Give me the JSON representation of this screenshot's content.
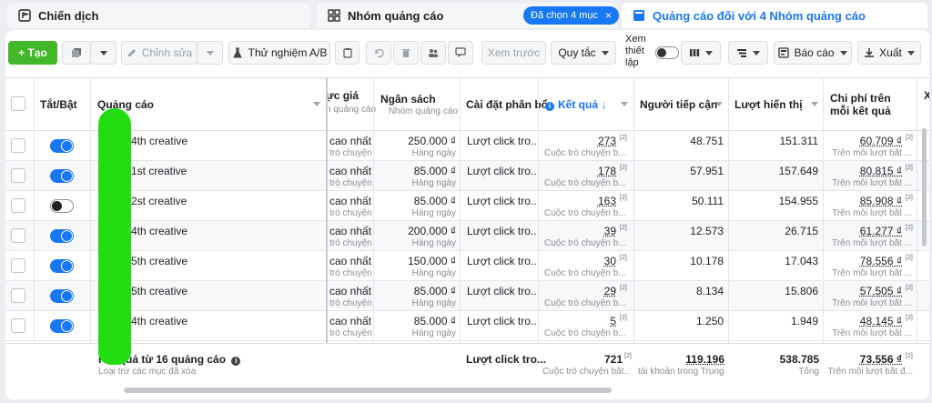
{
  "tabs": [
    {
      "label": "Chiến dịch"
    },
    {
      "label": "Nhóm quảng cáo"
    },
    {
      "label": "Quảng cáo đối với 4 Nhóm quảng cáo"
    }
  ],
  "selection_chip": {
    "label": "Đã chọn 4 mục",
    "close": "×"
  },
  "toolbar": {
    "create": "+ Tạo",
    "edit": "Chỉnh sửa",
    "ab_test": "Thử nghiệm A/B",
    "preview": "Xem trước",
    "rules": "Quy tắc",
    "view_setup": "Xem thiết lập",
    "reports": "Báo cáo",
    "export": "Xuất"
  },
  "columns": {
    "toggle": "Tắt/Bật",
    "ad": "Quảng cáo",
    "bid": "ực giá",
    "bid_sub": "n quảng cáo",
    "budget": "Ngân sách",
    "budget_sub": "Nhóm quảng cáo",
    "delivery": "Cài đặt phân bổ",
    "results": "Kết quả ↓",
    "reach": "Người tiếp cận",
    "impressions": "Lượt hiển thị",
    "cost": "Chi phí trên mỗi kết quả",
    "more": "X"
  },
  "rows": [
    {
      "enabled": true,
      "name": "4th creative",
      "bid": "cao nhất",
      "bid_sub": "trò chuyện",
      "budget": "250.000 ₫",
      "budget_sub": "Hàng ngày",
      "delivery": "Lượt click tro...",
      "results": "273",
      "results_sub": "Cuộc trò chuyện b...",
      "reach": "48.751",
      "impressions": "151.311",
      "cost": "60.709 ₫",
      "cost_sub": "Trên mỗi lượt bắt ..."
    },
    {
      "enabled": true,
      "name": "1st creative",
      "bid": "cao nhất",
      "bid_sub": "trò chuyện",
      "budget": "85.000 ₫",
      "budget_sub": "Hàng ngày",
      "delivery": "Lượt click tro...",
      "results": "178",
      "results_sub": "Cuộc trò chuyện b...",
      "reach": "57.951",
      "impressions": "157.649",
      "cost": "80.815 ₫",
      "cost_sub": "Trên mỗi lượt bắt ..."
    },
    {
      "enabled": false,
      "name": "2st creative",
      "bid": "cao nhất",
      "bid_sub": "trò chuyện",
      "budget": "85.000 ₫",
      "budget_sub": "Hàng ngày",
      "delivery": "Lượt click tro...",
      "results": "163",
      "results_sub": "Cuộc trò chuyện b...",
      "reach": "50.111",
      "impressions": "154.955",
      "cost": "85.908 ₫",
      "cost_sub": "Trên mỗi lượt bắt ..."
    },
    {
      "enabled": true,
      "name": "4th creative",
      "bid": "cao nhất",
      "bid_sub": "trò chuyện",
      "budget": "200.000 ₫",
      "budget_sub": "Hàng ngày",
      "delivery": "Lượt click tro...",
      "results": "39",
      "results_sub": "Cuộc trò chuyện b...",
      "reach": "12.573",
      "impressions": "26.715",
      "cost": "61.277 ₫",
      "cost_sub": "Trên mỗi lượt bắt ..."
    },
    {
      "enabled": true,
      "name": "5th creative",
      "bid": "cao nhất",
      "bid_sub": "trò chuyện",
      "budget": "150.000 ₫",
      "budget_sub": "Hàng ngày",
      "delivery": "Lượt click tro...",
      "results": "30",
      "results_sub": "Cuộc trò chuyện b...",
      "reach": "10.178",
      "impressions": "17.043",
      "cost": "78.556 ₫",
      "cost_sub": "Trên mỗi lượt bắt ..."
    },
    {
      "enabled": true,
      "name": "5th creative",
      "bid": "cao nhất",
      "bid_sub": "trò chuyện",
      "budget": "85.000 ₫",
      "budget_sub": "Hàng ngày",
      "delivery": "Lượt click tro...",
      "results": "29",
      "results_sub": "Cuộc trò chuyện b...",
      "reach": "8.134",
      "impressions": "15.806",
      "cost": "57.505 ₫",
      "cost_sub": "Trên mỗi lượt bắt ..."
    },
    {
      "enabled": true,
      "name": "4th creative",
      "bid": "cao nhất",
      "bid_sub": "trò chuyện",
      "budget": "85.000 ₫",
      "budget_sub": "Hàng ngày",
      "delivery": "Lượt click tro...",
      "results": "5",
      "results_sub": "Cuộc trò chuyện b...",
      "reach": "1.250",
      "impressions": "1.949",
      "cost": "48.145 ₫",
      "cost_sub": "Trên mỗi lượt bắt ..."
    }
  ],
  "totals": {
    "label": "Kết quả từ 16 quảng cáo",
    "label_sub": "Loại trừ các mục đã xóa",
    "delivery": "Lượt click tro...",
    "results": "721",
    "results_sub": "Cuộc trò chuyện bắt...",
    "reach": "119.196",
    "reach_sub": "tài khoản trong Trung t...",
    "impressions": "538.785",
    "impressions_sub": "Tổng",
    "cost": "73.556 ₫",
    "cost_sub": "Trên mỗi lượt bắt đ..."
  },
  "sup": "[2]",
  "colors": {
    "accent": "#1877f2",
    "create": "#42b72a",
    "redaction": "#22dd11"
  }
}
